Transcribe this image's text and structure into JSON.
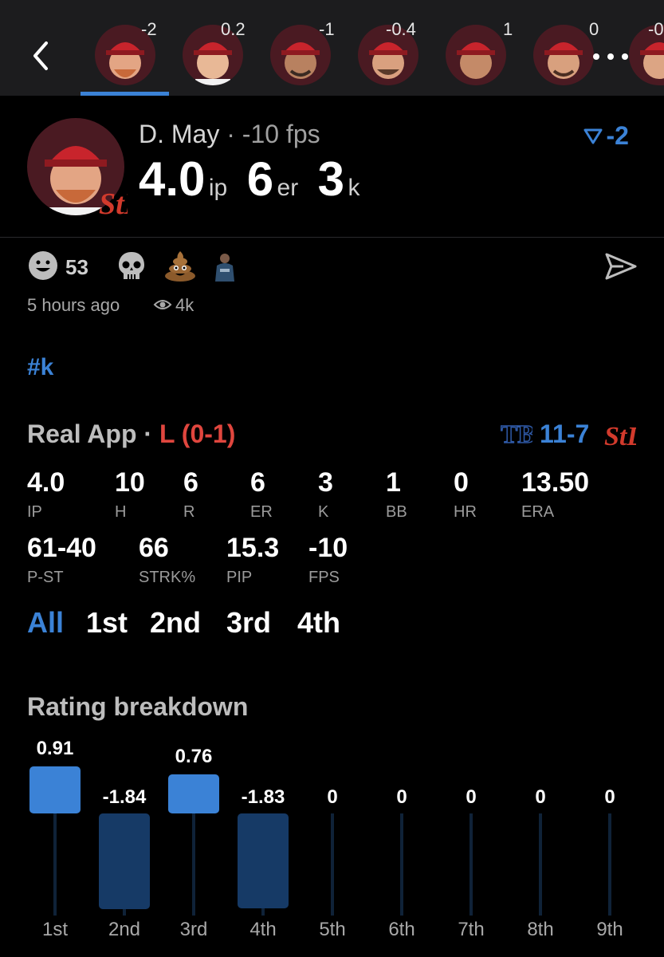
{
  "top_bar": {
    "deltas": [
      "-2",
      "0.2",
      "-1",
      "-0.4",
      "1",
      "0",
      "-0"
    ]
  },
  "player": {
    "name": "D. May",
    "fps_text": "· -10 fps",
    "ip": "4.0",
    "ip_unit": "ip",
    "er": "6",
    "er_unit": "er",
    "k": "3",
    "k_unit": "k",
    "vote": "-2"
  },
  "post": {
    "reaction_count": "53",
    "time_ago": "5 hours ago",
    "views": "4k",
    "hashtag": "#k"
  },
  "game": {
    "app_name": "Real App",
    "separator": "·",
    "result": "L (0-1)",
    "score_away": "11",
    "score_dash": "-",
    "score_home": "7",
    "stats_row1": [
      {
        "value": "4.0",
        "label": "IP"
      },
      {
        "value": "10",
        "label": "H"
      },
      {
        "value": "6",
        "label": "R"
      },
      {
        "value": "6",
        "label": "ER"
      },
      {
        "value": "3",
        "label": "K"
      },
      {
        "value": "1",
        "label": "BB"
      },
      {
        "value": "0",
        "label": "HR"
      },
      {
        "value": "13.50",
        "label": "ERA"
      }
    ],
    "stats_row2": [
      {
        "value": "61-40",
        "label": "P-ST"
      },
      {
        "value": "66",
        "label": "STRK%"
      },
      {
        "value": "15.3",
        "label": "PIP"
      },
      {
        "value": "-10",
        "label": "FPS"
      }
    ],
    "inning_tabs": [
      "All",
      "1st",
      "2nd",
      "3rd",
      "4th"
    ]
  },
  "chart_title": "Rating breakdown",
  "colors": {
    "accent_blue": "#3b82d6",
    "negative_bar": "#163a66",
    "loss_red": "#e0463e",
    "cardinals_red": "#d23a2c"
  },
  "chart_data": {
    "type": "bar",
    "title": "Rating breakdown",
    "categories": [
      "1st",
      "2nd",
      "3rd",
      "4th",
      "5th",
      "6th",
      "7th",
      "8th",
      "9th"
    ],
    "values": [
      0.91,
      -1.84,
      0.76,
      -1.83,
      0,
      0,
      0,
      0,
      0
    ],
    "value_labels": [
      "0.91",
      "-1.84",
      "0.76",
      "-1.83",
      "0",
      "0",
      "0",
      "0",
      "0"
    ]
  }
}
